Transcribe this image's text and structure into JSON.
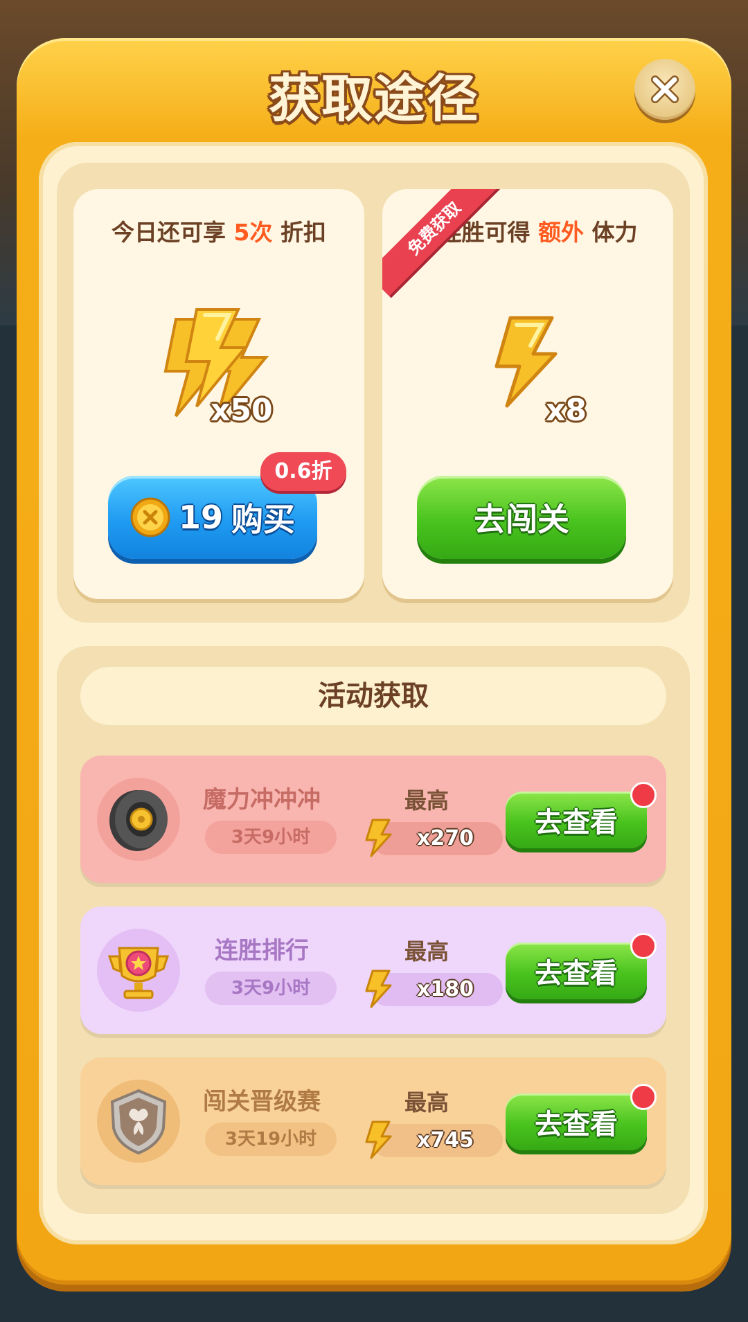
{
  "dialog": {
    "title": "获取途径"
  },
  "offer_purchase": {
    "head_prefix": "今日还可享",
    "head_highlight": "5次",
    "head_suffix": "折扣",
    "reward_quantity": "x50",
    "discount_badge": "0.6折",
    "button_price": "19",
    "button_label": "购买"
  },
  "offer_streak": {
    "ribbon": "免费获取",
    "head_prefix": "连胜可得",
    "head_highlight": "额外",
    "head_suffix": "体力",
    "reward_quantity": "x8",
    "button_label": "去闯关"
  },
  "activities": {
    "title": "活动获取",
    "items": [
      {
        "name": "魔力冲冲冲",
        "time_left": "3天9小时",
        "max_label": "最高",
        "amount": "x270",
        "button": "去查看"
      },
      {
        "name": "连胜排行",
        "time_left": "3天9小时",
        "max_label": "最高",
        "amount": "x180",
        "button": "去查看"
      },
      {
        "name": "闯关晋级赛",
        "time_left": "3天19小时",
        "max_label": "最高",
        "amount": "x745",
        "button": "去查看"
      }
    ]
  },
  "colors": {
    "frame": "#f2a614",
    "highlight": "#ff5a1f",
    "button_blue": "#1f9bf2",
    "button_green": "#49c31e",
    "badge_red": "#ef4a55"
  }
}
